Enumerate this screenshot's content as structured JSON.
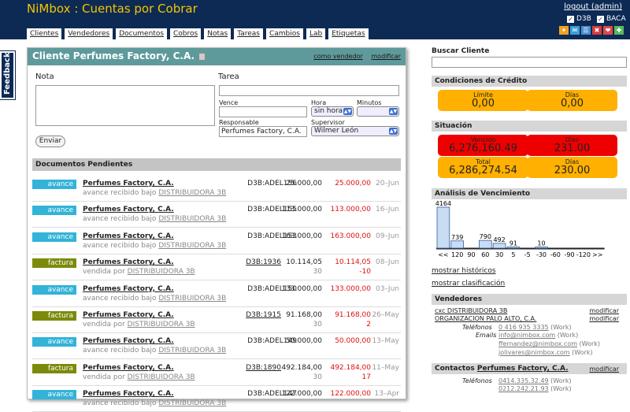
{
  "app": {
    "title": "NiMbox : Cuentas por Cobrar",
    "logout": "logout (admin)",
    "companies": [
      "D3B",
      "BACA"
    ]
  },
  "tabs": [
    "Clientes",
    "Vendedores",
    "Documentos",
    "Cobros",
    "Notas",
    "Tareas",
    "Cambios",
    "Lab",
    "Etiquetas"
  ],
  "feedback": "Feedback",
  "client": {
    "title": "Cliente Perfumes Factory, C.A.",
    "link_vendor": "como vendedor",
    "link_modify": "modificar"
  },
  "form": {
    "nota_label": "Nota",
    "tarea_label": "Tarea",
    "vence_label": "Vence",
    "hora_label": "Hora",
    "hora_value": "sin hora",
    "minutos_label": "Minutos",
    "responsable_label": "Responsable",
    "responsable_value": "Perfumes Factory, C.A.",
    "supervisor_label": "Supervisor",
    "supervisor_value": "Wilmer León",
    "send": "Enviar"
  },
  "docs": {
    "header": "Documentos Pendientes",
    "rows": [
      {
        "type": "avance",
        "name": "Perfumes Factory, C.A.",
        "sub_prefix": "avance recibido bajo",
        "sub_link": "DISTRIBUIDORA 3B",
        "ref": "D3B:ADEL156",
        "amount": "25.000,00",
        "days": "",
        "balance": "25.000,00",
        "balance2": "",
        "date": "20–Jun"
      },
      {
        "type": "avance",
        "name": "Perfumes Factory, C.A.",
        "sub_prefix": "avance recibido bajo",
        "sub_link": "DISTRIBUIDORA 3B",
        "ref": "D3B:ADEL155",
        "amount": "113.000,00",
        "days": "",
        "balance": "113.000,00",
        "balance2": "",
        "date": "16–Jun"
      },
      {
        "type": "avance",
        "name": "Perfumes Factory, C.A.",
        "sub_prefix": "avance recibido bajo",
        "sub_link": "DISTRIBUIDORA 3B",
        "ref": "D3B:ADEL153",
        "amount": "163.000,00",
        "days": "",
        "balance": "163.000,00",
        "balance2": "",
        "date": "09–Jun"
      },
      {
        "type": "factura",
        "name": "Perfumes Factory, C.A.",
        "sub_prefix": "vendida por",
        "sub_link": "DISTRIBUIDORA 3B",
        "ref": "D3B:1936",
        "amount": "10.114,05",
        "days": "30",
        "balance": "10.114,05",
        "balance2": "-10",
        "date": "08–Jun"
      },
      {
        "type": "avance",
        "name": "Perfumes Factory, C.A.",
        "sub_prefix": "avance recibido bajo",
        "sub_link": "DISTRIBUIDORA 3B",
        "ref": "D3B:ADEL150",
        "amount": "133.000,00",
        "days": "",
        "balance": "133.000,00",
        "balance2": "",
        "date": "03–Jun"
      },
      {
        "type": "factura",
        "name": "Perfumes Factory, C.A.",
        "sub_prefix": "vendida por",
        "sub_link": "DISTRIBUIDORA 3B",
        "ref": "D3B:1915",
        "amount": "91.168,00",
        "days": "30",
        "balance": "91.168,00",
        "balance2": "2",
        "date": "26–May"
      },
      {
        "type": "avance",
        "name": "Perfumes Factory, C.A.",
        "sub_prefix": "avance recibido bajo",
        "sub_link": "DISTRIBUIDORA 3B",
        "ref": "D3B:ADEL149",
        "amount": "50.000,00",
        "days": "",
        "balance": "50.000,00",
        "balance2": "",
        "date": "13–May"
      },
      {
        "type": "factura",
        "name": "Perfumes Factory, C.A.",
        "sub_prefix": "vendida por",
        "sub_link": "DISTRIBUIDORA 3B",
        "ref": "D3B:1890",
        "amount": "492.184,00",
        "days": "30",
        "balance": "492.184,00",
        "balance2": "17",
        "date": "11–May"
      },
      {
        "type": "avance",
        "name": "Perfumes Factory, C.A.",
        "sub_prefix": "avance recibido bajo",
        "sub_link": "DISTRIBUIDORA 3B",
        "ref": "D3B:ADEL147",
        "amount": "122.000,00",
        "days": "",
        "balance": "122.000,00",
        "balance2": "",
        "date": "13–Apr"
      }
    ]
  },
  "right": {
    "search_label": "Buscar Cliente",
    "credit_title": "Condiciones de Crédito",
    "limit_label": "Límite",
    "limit_value": "0,00",
    "credit_days_label": "Días",
    "credit_days_value": "0,00",
    "situation_title": "Situación",
    "overdue_label": "Vencido",
    "overdue_value": "6,276,160.49",
    "overdue_days_label": "Días",
    "overdue_days_value": "231.00",
    "total_label": "Total",
    "total_value": "6,286,274.54",
    "total_days_label": "Días",
    "total_days_value": "230.00",
    "aging_title": "Análisis de Vencimiento",
    "show_history": "mostrar históricos",
    "show_classification": "mostrar clasificación",
    "vendors_title": "Vendedores",
    "vendor_lines": [
      "cxc DISTRIBUIDORA 3B",
      "ORGANIZACION PALO ALTO, C.A."
    ],
    "vendor_modify": "modificar",
    "phones_label": "Teléfonos",
    "vendor_phone": "0 416 935 3335",
    "vendor_phone_tag": "(Work)",
    "emails_label": "Emails",
    "emails": [
      "info@nimbox.com",
      "ffernandez@nimbox.com",
      "jolivares@nimbox.com"
    ],
    "email_tag": "(Work)",
    "contacts_title_prefix": "Contactos",
    "contacts_title_link": "Perfumes Factory, C.A.",
    "contacts_modify": "modificar",
    "contact_phones": [
      "0414.335.32.49",
      "0212.242.21.93"
    ],
    "contact_phone_tag": "(Work)"
  },
  "chart_data": {
    "type": "bar",
    "title": "Análisis de Vencimiento",
    "categories": [
      "<<",
      "120",
      "90",
      "60",
      "30",
      "5",
      "-5",
      "-30",
      "-60",
      "-90",
      "-120",
      ">>"
    ],
    "values": [
      4164,
      739,
      0,
      790,
      492,
      91,
      0,
      10,
      0,
      0,
      0,
      0
    ],
    "value_labels": [
      "4164",
      "739",
      "",
      "790",
      "492",
      "91",
      "",
      "10",
      "",
      "",
      "",
      ""
    ],
    "bar_color": "#c8dcf4",
    "ylim": [
      0,
      4164
    ]
  }
}
